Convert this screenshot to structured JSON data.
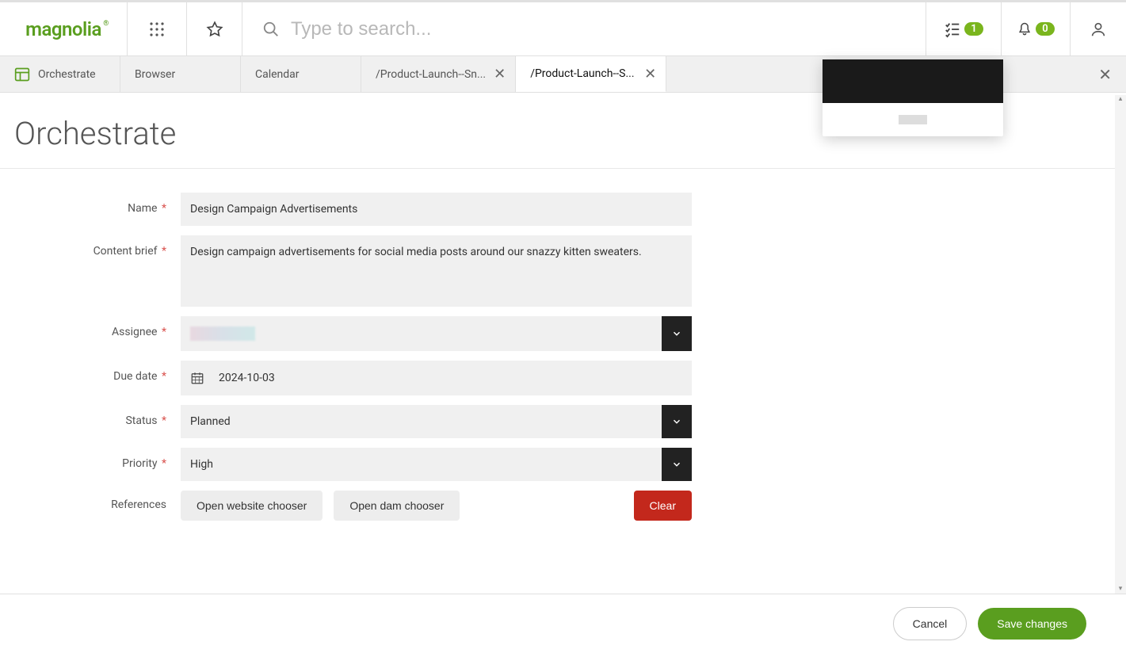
{
  "header": {
    "logo": "magnolia",
    "search_placeholder": "Type to search...",
    "tasks_badge": "1",
    "notifications_badge": "0"
  },
  "tabs": {
    "items": [
      {
        "label": "Orchestrate",
        "closable": false,
        "active": false,
        "primary": true
      },
      {
        "label": "Browser",
        "closable": false,
        "active": false,
        "primary": false
      },
      {
        "label": "Calendar",
        "closable": false,
        "active": false,
        "primary": false
      },
      {
        "label": "/Product-Launch--Sn...",
        "closable": true,
        "active": false,
        "primary": false
      },
      {
        "label": "/Product-Launch--S...",
        "closable": true,
        "active": true,
        "primary": false
      }
    ]
  },
  "page": {
    "title": "Orchestrate"
  },
  "form": {
    "name": {
      "label": "Name",
      "value": "Design Campaign Advertisements",
      "required": true
    },
    "content_brief": {
      "label": "Content brief",
      "value": "Design campaign advertisements for social media posts around our snazzy kitten sweaters.",
      "required": true
    },
    "assignee": {
      "label": "Assignee",
      "value": "",
      "required": true
    },
    "due_date": {
      "label": "Due date",
      "value": "2024-10-03",
      "required": true
    },
    "status": {
      "label": "Status",
      "value": "Planned",
      "required": true
    },
    "priority": {
      "label": "Priority",
      "value": "High",
      "required": true
    },
    "references": {
      "label": "References",
      "open_website": "Open website chooser",
      "open_dam": "Open dam chooser",
      "clear": "Clear"
    }
  },
  "footer": {
    "cancel": "Cancel",
    "save": "Save changes"
  }
}
